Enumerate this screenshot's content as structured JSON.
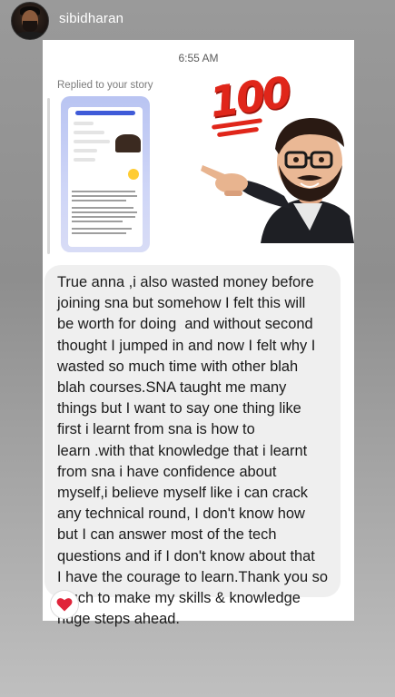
{
  "header": {
    "username": "sibidharan"
  },
  "thread": {
    "timestamp": "6:55 AM",
    "reply_context": "Replied to your story",
    "sticker_text": "100",
    "message": "True anna ,i also wasted money before\njoining sna but somehow I felt this will\nbe worth for doing  and without second\nthought I jumped in and now I felt why I\nwasted so much time with other blah\nblah courses.SNA taught me many\nthings but I want to say one thing like\nfirst i learnt from sna is how to\nlearn .with that knowledge that i learnt\nfrom sna i have confidence about\nmyself,i believe myself like i can crack\nany technical round, I don't know how\nbut I can answer most of the tech\nquestions and if I don't know about that\nI have the courage to learn.Thank you so\nmuch to make my skills & knowledge\nhuge steps ahead.",
    "reaction_icon": "red-heart"
  },
  "colors": {
    "bubble": "#efefef",
    "heart": "#e0243a",
    "sticker_red": "#e0261a"
  }
}
